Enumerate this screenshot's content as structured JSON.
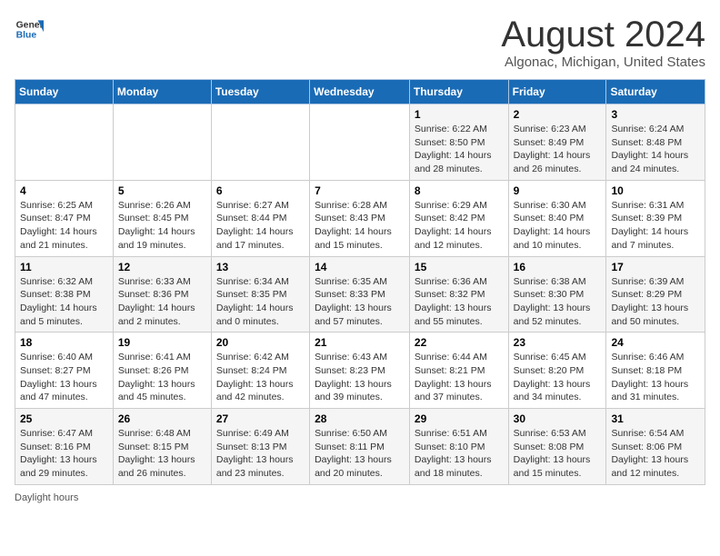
{
  "header": {
    "logo_line1": "General",
    "logo_line2": "Blue",
    "month_year": "August 2024",
    "location": "Algonac, Michigan, United States"
  },
  "days_of_week": [
    "Sunday",
    "Monday",
    "Tuesday",
    "Wednesday",
    "Thursday",
    "Friday",
    "Saturday"
  ],
  "weeks": [
    [
      {
        "day": "",
        "info": ""
      },
      {
        "day": "",
        "info": ""
      },
      {
        "day": "",
        "info": ""
      },
      {
        "day": "",
        "info": ""
      },
      {
        "day": "1",
        "info": "Sunrise: 6:22 AM\nSunset: 8:50 PM\nDaylight: 14 hours and 28 minutes."
      },
      {
        "day": "2",
        "info": "Sunrise: 6:23 AM\nSunset: 8:49 PM\nDaylight: 14 hours and 26 minutes."
      },
      {
        "day": "3",
        "info": "Sunrise: 6:24 AM\nSunset: 8:48 PM\nDaylight: 14 hours and 24 minutes."
      }
    ],
    [
      {
        "day": "4",
        "info": "Sunrise: 6:25 AM\nSunset: 8:47 PM\nDaylight: 14 hours and 21 minutes."
      },
      {
        "day": "5",
        "info": "Sunrise: 6:26 AM\nSunset: 8:45 PM\nDaylight: 14 hours and 19 minutes."
      },
      {
        "day": "6",
        "info": "Sunrise: 6:27 AM\nSunset: 8:44 PM\nDaylight: 14 hours and 17 minutes."
      },
      {
        "day": "7",
        "info": "Sunrise: 6:28 AM\nSunset: 8:43 PM\nDaylight: 14 hours and 15 minutes."
      },
      {
        "day": "8",
        "info": "Sunrise: 6:29 AM\nSunset: 8:42 PM\nDaylight: 14 hours and 12 minutes."
      },
      {
        "day": "9",
        "info": "Sunrise: 6:30 AM\nSunset: 8:40 PM\nDaylight: 14 hours and 10 minutes."
      },
      {
        "day": "10",
        "info": "Sunrise: 6:31 AM\nSunset: 8:39 PM\nDaylight: 14 hours and 7 minutes."
      }
    ],
    [
      {
        "day": "11",
        "info": "Sunrise: 6:32 AM\nSunset: 8:38 PM\nDaylight: 14 hours and 5 minutes."
      },
      {
        "day": "12",
        "info": "Sunrise: 6:33 AM\nSunset: 8:36 PM\nDaylight: 14 hours and 2 minutes."
      },
      {
        "day": "13",
        "info": "Sunrise: 6:34 AM\nSunset: 8:35 PM\nDaylight: 14 hours and 0 minutes."
      },
      {
        "day": "14",
        "info": "Sunrise: 6:35 AM\nSunset: 8:33 PM\nDaylight: 13 hours and 57 minutes."
      },
      {
        "day": "15",
        "info": "Sunrise: 6:36 AM\nSunset: 8:32 PM\nDaylight: 13 hours and 55 minutes."
      },
      {
        "day": "16",
        "info": "Sunrise: 6:38 AM\nSunset: 8:30 PM\nDaylight: 13 hours and 52 minutes."
      },
      {
        "day": "17",
        "info": "Sunrise: 6:39 AM\nSunset: 8:29 PM\nDaylight: 13 hours and 50 minutes."
      }
    ],
    [
      {
        "day": "18",
        "info": "Sunrise: 6:40 AM\nSunset: 8:27 PM\nDaylight: 13 hours and 47 minutes."
      },
      {
        "day": "19",
        "info": "Sunrise: 6:41 AM\nSunset: 8:26 PM\nDaylight: 13 hours and 45 minutes."
      },
      {
        "day": "20",
        "info": "Sunrise: 6:42 AM\nSunset: 8:24 PM\nDaylight: 13 hours and 42 minutes."
      },
      {
        "day": "21",
        "info": "Sunrise: 6:43 AM\nSunset: 8:23 PM\nDaylight: 13 hours and 39 minutes."
      },
      {
        "day": "22",
        "info": "Sunrise: 6:44 AM\nSunset: 8:21 PM\nDaylight: 13 hours and 37 minutes."
      },
      {
        "day": "23",
        "info": "Sunrise: 6:45 AM\nSunset: 8:20 PM\nDaylight: 13 hours and 34 minutes."
      },
      {
        "day": "24",
        "info": "Sunrise: 6:46 AM\nSunset: 8:18 PM\nDaylight: 13 hours and 31 minutes."
      }
    ],
    [
      {
        "day": "25",
        "info": "Sunrise: 6:47 AM\nSunset: 8:16 PM\nDaylight: 13 hours and 29 minutes."
      },
      {
        "day": "26",
        "info": "Sunrise: 6:48 AM\nSunset: 8:15 PM\nDaylight: 13 hours and 26 minutes."
      },
      {
        "day": "27",
        "info": "Sunrise: 6:49 AM\nSunset: 8:13 PM\nDaylight: 13 hours and 23 minutes."
      },
      {
        "day": "28",
        "info": "Sunrise: 6:50 AM\nSunset: 8:11 PM\nDaylight: 13 hours and 20 minutes."
      },
      {
        "day": "29",
        "info": "Sunrise: 6:51 AM\nSunset: 8:10 PM\nDaylight: 13 hours and 18 minutes."
      },
      {
        "day": "30",
        "info": "Sunrise: 6:53 AM\nSunset: 8:08 PM\nDaylight: 13 hours and 15 minutes."
      },
      {
        "day": "31",
        "info": "Sunrise: 6:54 AM\nSunset: 8:06 PM\nDaylight: 13 hours and 12 minutes."
      }
    ]
  ],
  "footer": {
    "daylight_label": "Daylight hours"
  }
}
